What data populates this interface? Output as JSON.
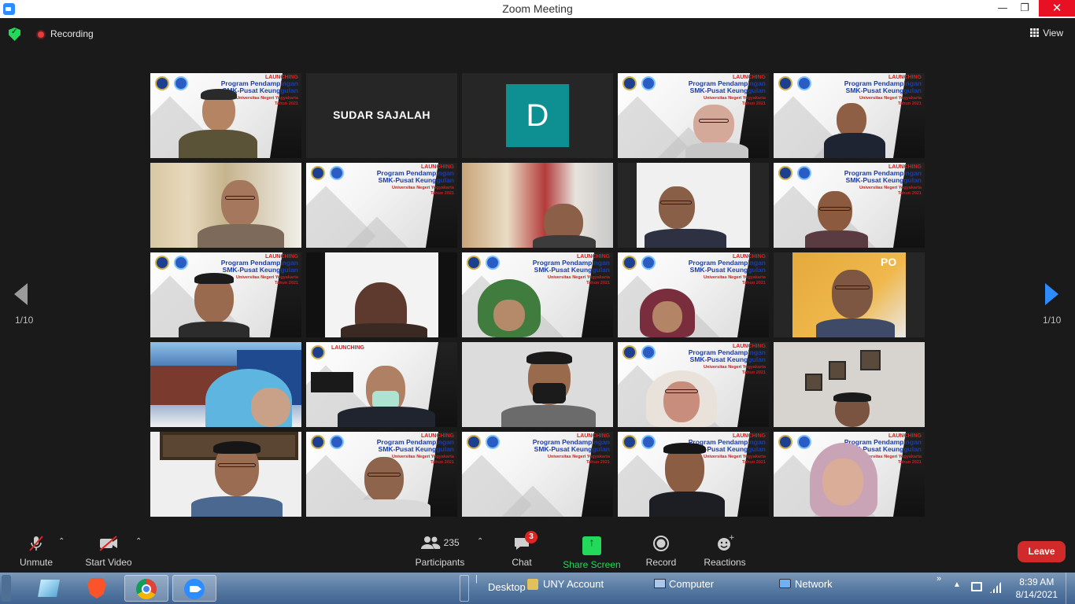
{
  "window": {
    "title": "Zoom Meeting"
  },
  "topbar": {
    "recording_label": "Recording",
    "view_label": "View"
  },
  "pagination": {
    "left": "1/10",
    "right": "1/10"
  },
  "tiles": {
    "t2_name": "SUDAR SAJALAH",
    "t3_avatar": "D"
  },
  "slide_text": {
    "launch": "LAUNCHING",
    "program": "Program Pendampingan",
    "subprogram": "SMK-Pusat Keunggulan",
    "univ": "Universitas Negeri Yogyakarta",
    "year": "Tahun 2021"
  },
  "toolbar": {
    "unmute": "Unmute",
    "start_video": "Start Video",
    "participants_count": "235",
    "participants": "Participants",
    "chat": "Chat",
    "chat_badge": "3",
    "share_screen": "Share Screen",
    "record": "Record",
    "reactions": "Reactions",
    "leave": "Leave"
  },
  "taskbar": {
    "desktop": "Desktop",
    "uny_account": "UNY Account",
    "computer": "Computer",
    "network": "Network",
    "time": "8:39 AM",
    "date": "8/14/2021"
  },
  "colors": {
    "accent_green": "#23d959",
    "leave_red": "#d12a2a",
    "active_speaker": "#d2e94a",
    "avatar_teal": "#0e8f92"
  }
}
